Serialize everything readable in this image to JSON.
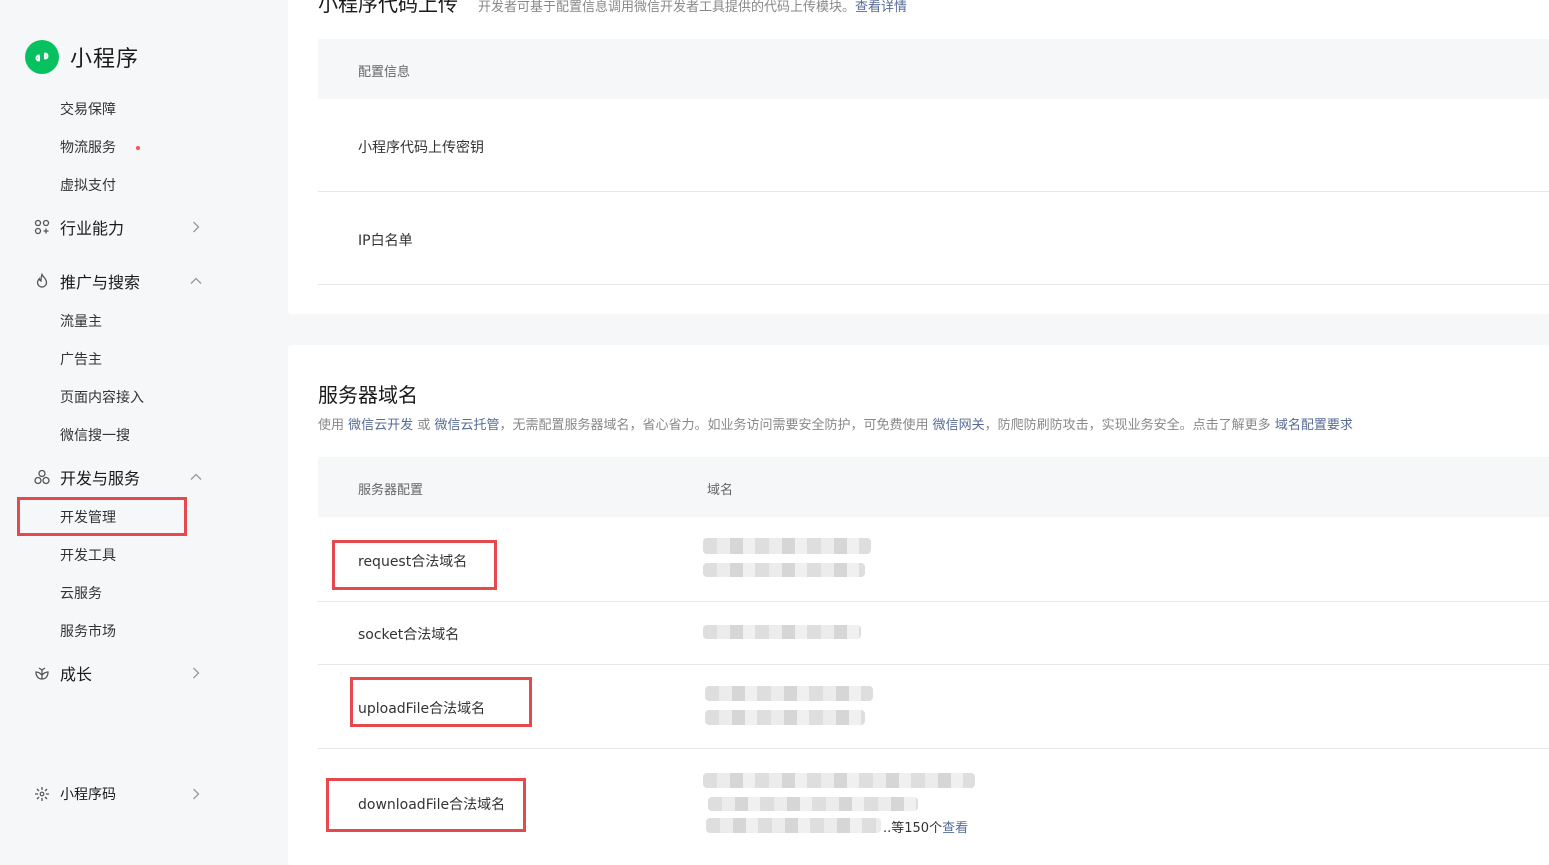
{
  "sidebar": {
    "app_title": "小程序",
    "items": {
      "trade_guarantee": "交易保障",
      "logistics": "物流服务",
      "virtual_pay": "虚拟支付",
      "industry": "行业能力",
      "promotion": "推广与搜索",
      "traffic_owner": "流量主",
      "advertiser": "广告主",
      "page_access": "页面内容接入",
      "wechat_search": "微信搜一搜",
      "dev_service": "开发与服务",
      "dev_manage": "开发管理",
      "dev_tools": "开发工具",
      "cloud_service": "云服务",
      "service_market": "服务市场",
      "growth": "成长",
      "mini_code": "小程序码"
    }
  },
  "upload": {
    "title": "小程序代码上传",
    "desc": "开发者可基于配置信息调用微信开发者工具提供的代码上传模块。",
    "link": "查看详情",
    "table_header": "配置信息",
    "rows": [
      "小程序代码上传密钥",
      "IP白名单"
    ]
  },
  "domain": {
    "title": "服务器域名",
    "desc": {
      "p1": "使用",
      "l1": "微信云开发",
      "p2": "或",
      "l2": "微信云托管",
      "p3": "，无需配置服务器域名，省心省力。如业务访问需要安全防护，可免费使用",
      "l3": "微信网关",
      "p4": "，防爬防刷防攻击，实现业务安全。点击了解更多",
      "l4": "域名配置要求"
    },
    "header": {
      "config": "服务器配置",
      "domain": "域名"
    },
    "rows": [
      "request合法域名",
      "socket合法域名",
      "uploadFile合法域名",
      "downloadFile合法域名"
    ],
    "more_text": "..等150个",
    "more_link": "查看"
  },
  "colors": {
    "accent": "#07c160",
    "link": "#576b95",
    "highlight": "#e5484d"
  }
}
